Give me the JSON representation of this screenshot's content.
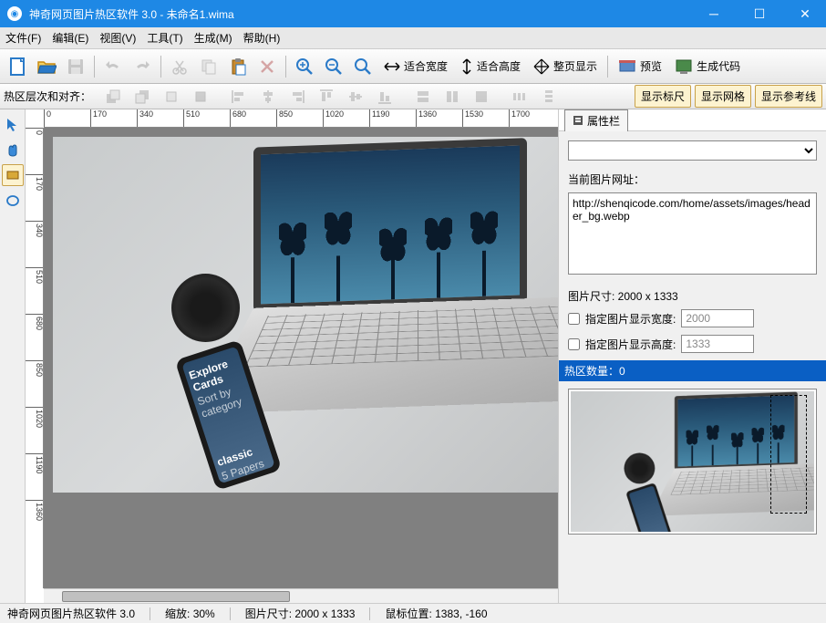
{
  "titlebar": {
    "title": "神奇网页图片热区软件 3.0 - 未命名1.wima"
  },
  "menu": {
    "file": "文件(F)",
    "edit": "编辑(E)",
    "view": "视图(V)",
    "tools": "工具(T)",
    "generate": "生成(M)",
    "help": "帮助(H)"
  },
  "toolbar": {
    "fit_width": "适合宽度",
    "fit_height": "适合高度",
    "fit_page": "整页显示",
    "preview": "预览",
    "generate_code": "生成代码"
  },
  "toolbar2": {
    "label": "热区层次和对齐：",
    "show_ruler": "显示标尺",
    "show_grid": "显示网格",
    "show_guides": "显示参考线"
  },
  "ruler_h_ticks": [
    "0",
    "170",
    "340",
    "510",
    "680",
    "850",
    "1020",
    "1190",
    "1360",
    "1530",
    "1700"
  ],
  "ruler_v_ticks": [
    "0",
    "170",
    "340",
    "510",
    "680",
    "850",
    "1020",
    "1190",
    "1360"
  ],
  "panel": {
    "tab": "属性栏",
    "url_label": "当前图片网址：",
    "url_value": "http://shenqicode.com/home/assets/images/header_bg.webp",
    "size_label": "图片尺寸:  2000 x 1333",
    "width_check": "指定图片显示宽度:",
    "width_value": "2000",
    "height_check": "指定图片显示高度:",
    "height_value": "1333",
    "hotspot_count": "热区数量：0"
  },
  "phone": {
    "title": "Explore Cards",
    "sub": "Sort by category",
    "card": "classic",
    "card_sub": "5 Papers"
  },
  "status": {
    "app": "神奇网页图片热区软件 3.0",
    "zoom": "缩放: 30%",
    "size": "图片尺寸:  2000 x 1333",
    "mouse": "鼠标位置:  1383, -160"
  }
}
